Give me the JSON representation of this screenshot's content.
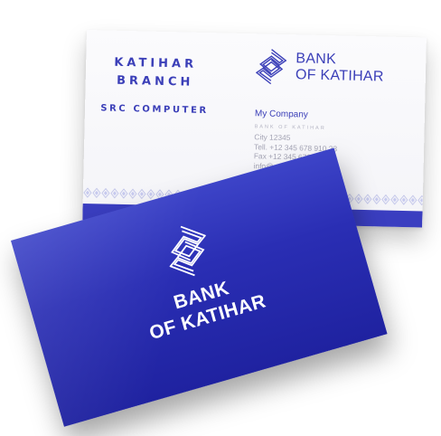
{
  "back_card": {
    "left_title_line1": "KATIHAR",
    "left_title_line2": "BRANCH",
    "left_subtitle": "SRC COMPUTER",
    "brand_line1": "BANK",
    "brand_line2": "OF KATIHAR",
    "logo_icon": "interlocking-s-icon",
    "contact": {
      "company": "My Company",
      "tagline": "BANK OF KATIHAR",
      "city": "City 12345",
      "tel": "Tell. +12 345 678 910 23",
      "fax": "Fax +12 345 678 910 23",
      "email": "info@"
    },
    "colors": {
      "accent": "#3b3fb8",
      "text_gray": "#a4a4b4",
      "stripe": "#3a3ec0"
    }
  },
  "front_card": {
    "brand_line1": "BANK",
    "brand_line2": "OF KATIHAR",
    "logo_icon": "interlocking-s-icon",
    "colors": {
      "background": "#2a2eb4",
      "text": "#ffffff"
    }
  }
}
